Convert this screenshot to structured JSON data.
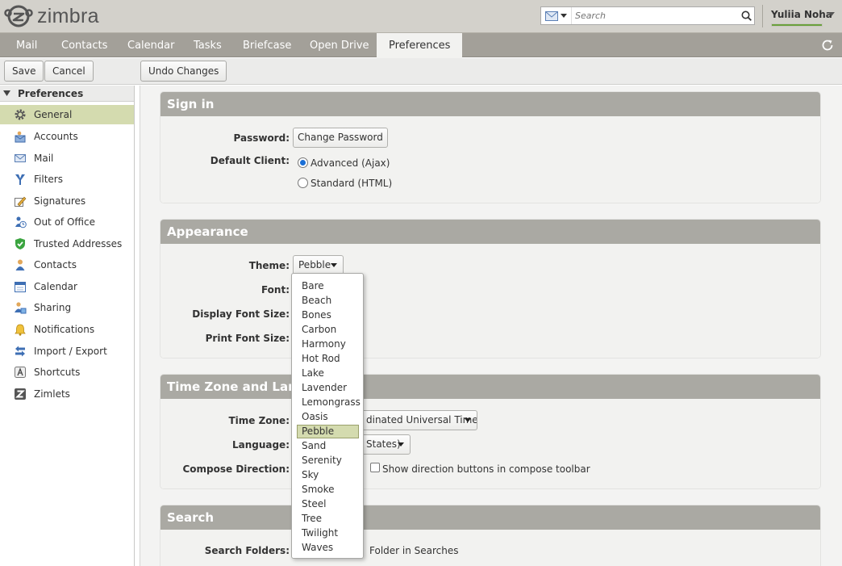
{
  "header": {
    "logo_text": "zimbra",
    "search_placeholder": "Search",
    "user_name": "Yuliia Noha",
    "quota_fraction": 1.0
  },
  "app_tabs": [
    {
      "label": "Mail"
    },
    {
      "label": "Contacts"
    },
    {
      "label": "Calendar"
    },
    {
      "label": "Tasks"
    },
    {
      "label": "Briefcase"
    },
    {
      "label": "Open Drive"
    },
    {
      "label": "Preferences",
      "active": true
    }
  ],
  "toolbar": {
    "save_label": "Save",
    "cancel_label": "Cancel",
    "undo_label": "Undo Changes"
  },
  "sidebar": {
    "header": "Preferences",
    "items": [
      {
        "label": "General",
        "icon": "gear-icon",
        "selected": true
      },
      {
        "label": "Accounts",
        "icon": "accounts-icon"
      },
      {
        "label": "Mail",
        "icon": "envelope-icon"
      },
      {
        "label": "Filters",
        "icon": "filter-icon"
      },
      {
        "label": "Signatures",
        "icon": "signature-icon"
      },
      {
        "label": "Out of Office",
        "icon": "out-of-office-icon"
      },
      {
        "label": "Trusted Addresses",
        "icon": "shield-check-icon"
      },
      {
        "label": "Contacts",
        "icon": "contact-icon"
      },
      {
        "label": "Calendar",
        "icon": "calendar-icon"
      },
      {
        "label": "Sharing",
        "icon": "sharing-icon"
      },
      {
        "label": "Notifications",
        "icon": "bell-icon"
      },
      {
        "label": "Import / Export",
        "icon": "import-export-icon"
      },
      {
        "label": "Shortcuts",
        "icon": "shortcuts-icon"
      },
      {
        "label": "Zimlets",
        "icon": "zimlets-icon"
      }
    ]
  },
  "sections": {
    "signin": {
      "title": "Sign in",
      "password_label": "Password:",
      "change_password": "Change Password",
      "default_client_label": "Default Client:",
      "advanced": "Advanced (Ajax)",
      "standard": "Standard (HTML)"
    },
    "appearance": {
      "title": "Appearance",
      "theme_label": "Theme:",
      "theme_value": "Pebble",
      "font_label": "Font:",
      "display_font_label": "Display Font Size:",
      "print_font_label": "Print Font Size:"
    },
    "timezone": {
      "title": "Time Zone and Lang",
      "timezone_label": "Time Zone:",
      "timezone_value": "dinated Universal Time",
      "language_label": "Language:",
      "language_value": "States)",
      "compose_label": "Compose Direction:",
      "compose_checkbox": "Show direction buttons in compose toolbar"
    },
    "search": {
      "title": "Search",
      "folders_label": "Search Folders:",
      "folders_text": "Folder in Searches"
    }
  },
  "theme_options": [
    "Bare",
    "Beach",
    "Bones",
    "Carbon",
    "Harmony",
    "Hot Rod",
    "Lake",
    "Lavender",
    "Lemongrass",
    "Oasis",
    "Pebble",
    "Sand",
    "Serenity",
    "Sky",
    "Smoke",
    "Steel",
    "Tree",
    "Twilight",
    "Waves"
  ],
  "theme_selected": "Pebble",
  "colors": {
    "accent_selected": "#d4dbaf",
    "panel_header": "#aaa9a3",
    "tabbar": "#a3a099"
  }
}
